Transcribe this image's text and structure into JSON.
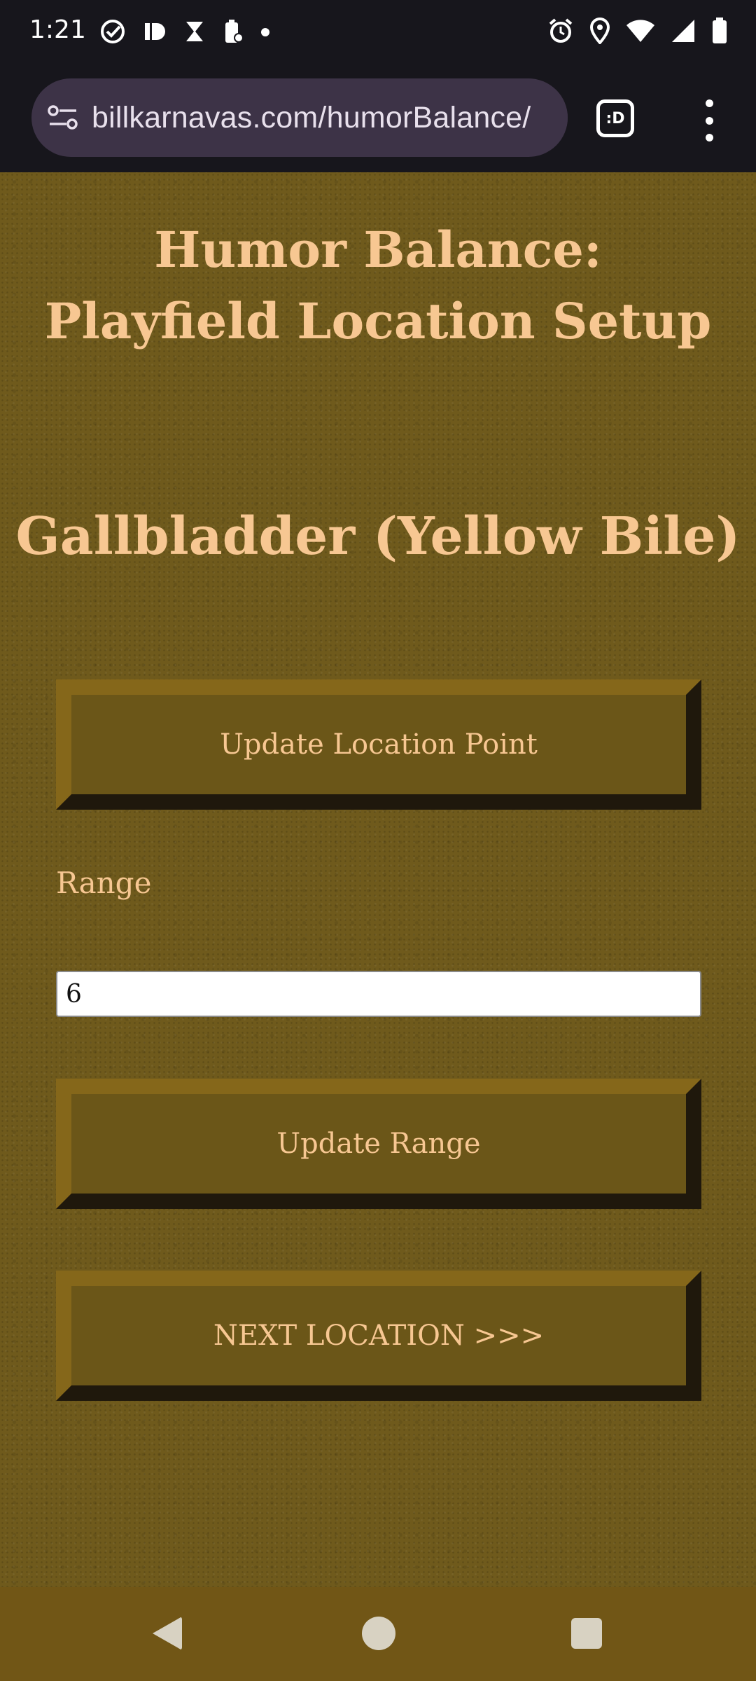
{
  "status_bar": {
    "time": "1:21",
    "left_icons": [
      "check-circle-icon",
      "pd-app-icon",
      "hourglass-icon",
      "battery-saver-icon",
      "dot-icon"
    ],
    "right_icons": [
      "alarm-icon",
      "location-icon",
      "wifi-icon",
      "signal-icon",
      "battery-icon"
    ]
  },
  "browser": {
    "url": "billkarnavas.com/humorBalance/",
    "tab_label": ":D"
  },
  "page": {
    "title_line1": "Humor Balance:",
    "title_line2": "Playfield Location Setup",
    "location_name": "Gallbladder (Yellow Bile)",
    "update_location_button": "Update Location Point",
    "range_label": "Range",
    "range_value": "6",
    "update_range_button": "Update Range",
    "next_location_button": "NEXT LOCATION >>>"
  },
  "colors": {
    "page_background": "#6f5a1c",
    "heading_text": "#f7c792",
    "button_face": "#6b5618",
    "nav_bar": "#715616"
  }
}
